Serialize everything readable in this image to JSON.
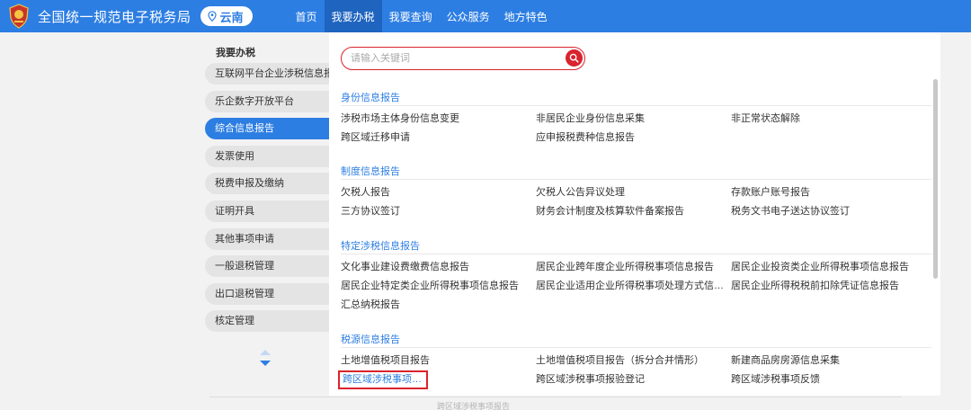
{
  "header": {
    "site_title": "全国统一规范电子税务局",
    "region": "云南",
    "nav": [
      "首页",
      "我要办税",
      "我要查询",
      "公众服务",
      "地方特色"
    ],
    "nav_active": 1
  },
  "sidebar": {
    "title": "我要办税",
    "items": [
      "互联网平台企业涉税信息报送",
      "乐企数字开放平台",
      "综合信息报告",
      "发票使用",
      "税费申报及缴纳",
      "证明开具",
      "其他事项申请",
      "一般退税管理",
      "出口退税管理",
      "核定管理"
    ],
    "active_index": 2
  },
  "search": {
    "placeholder": "请输入关键词",
    "value": ""
  },
  "sections": [
    {
      "title": "身份信息报告",
      "links": [
        "涉税市场主体身份信息变更",
        "非居民企业身份信息采集",
        "非正常状态解除",
        "跨区域迁移申请",
        "应申报税费种信息报告"
      ]
    },
    {
      "title": "制度信息报告",
      "links": [
        "欠税人报告",
        "欠税人公告异议处理",
        "存款账户账号报告",
        "三方协议签订",
        "财务会计制度及核算软件备案报告",
        "税务文书电子送达协议签订"
      ]
    },
    {
      "title": "特定涉税信息报告",
      "links": [
        "文化事业建设费缴费信息报告",
        "居民企业跨年度企业所得税事项信息报告",
        "居民企业投资类企业所得税事项信息报告",
        "居民企业特定类企业所得税事项信息报告",
        "居民企业适用企业所得税事项处理方式信息报...",
        "居民企业所得税税前扣除凭证信息报告",
        "汇总纳税报告"
      ]
    },
    {
      "title": "税源信息报告",
      "links": [
        "土地增值税项目报告",
        "土地增值税项目报告（拆分合并情形）",
        "新建商品房房源信息采集",
        "跨区域涉税事项报告",
        "跨区域涉税事项报验登记",
        "跨区域涉税事项反馈"
      ],
      "highlight_index": 3
    }
  ],
  "footer_ghost": "跨区域涉税事项报告",
  "colors": {
    "primary": "#2d7ee2",
    "nav_active": "#1f64bf",
    "accent_red": "#d9232d"
  }
}
